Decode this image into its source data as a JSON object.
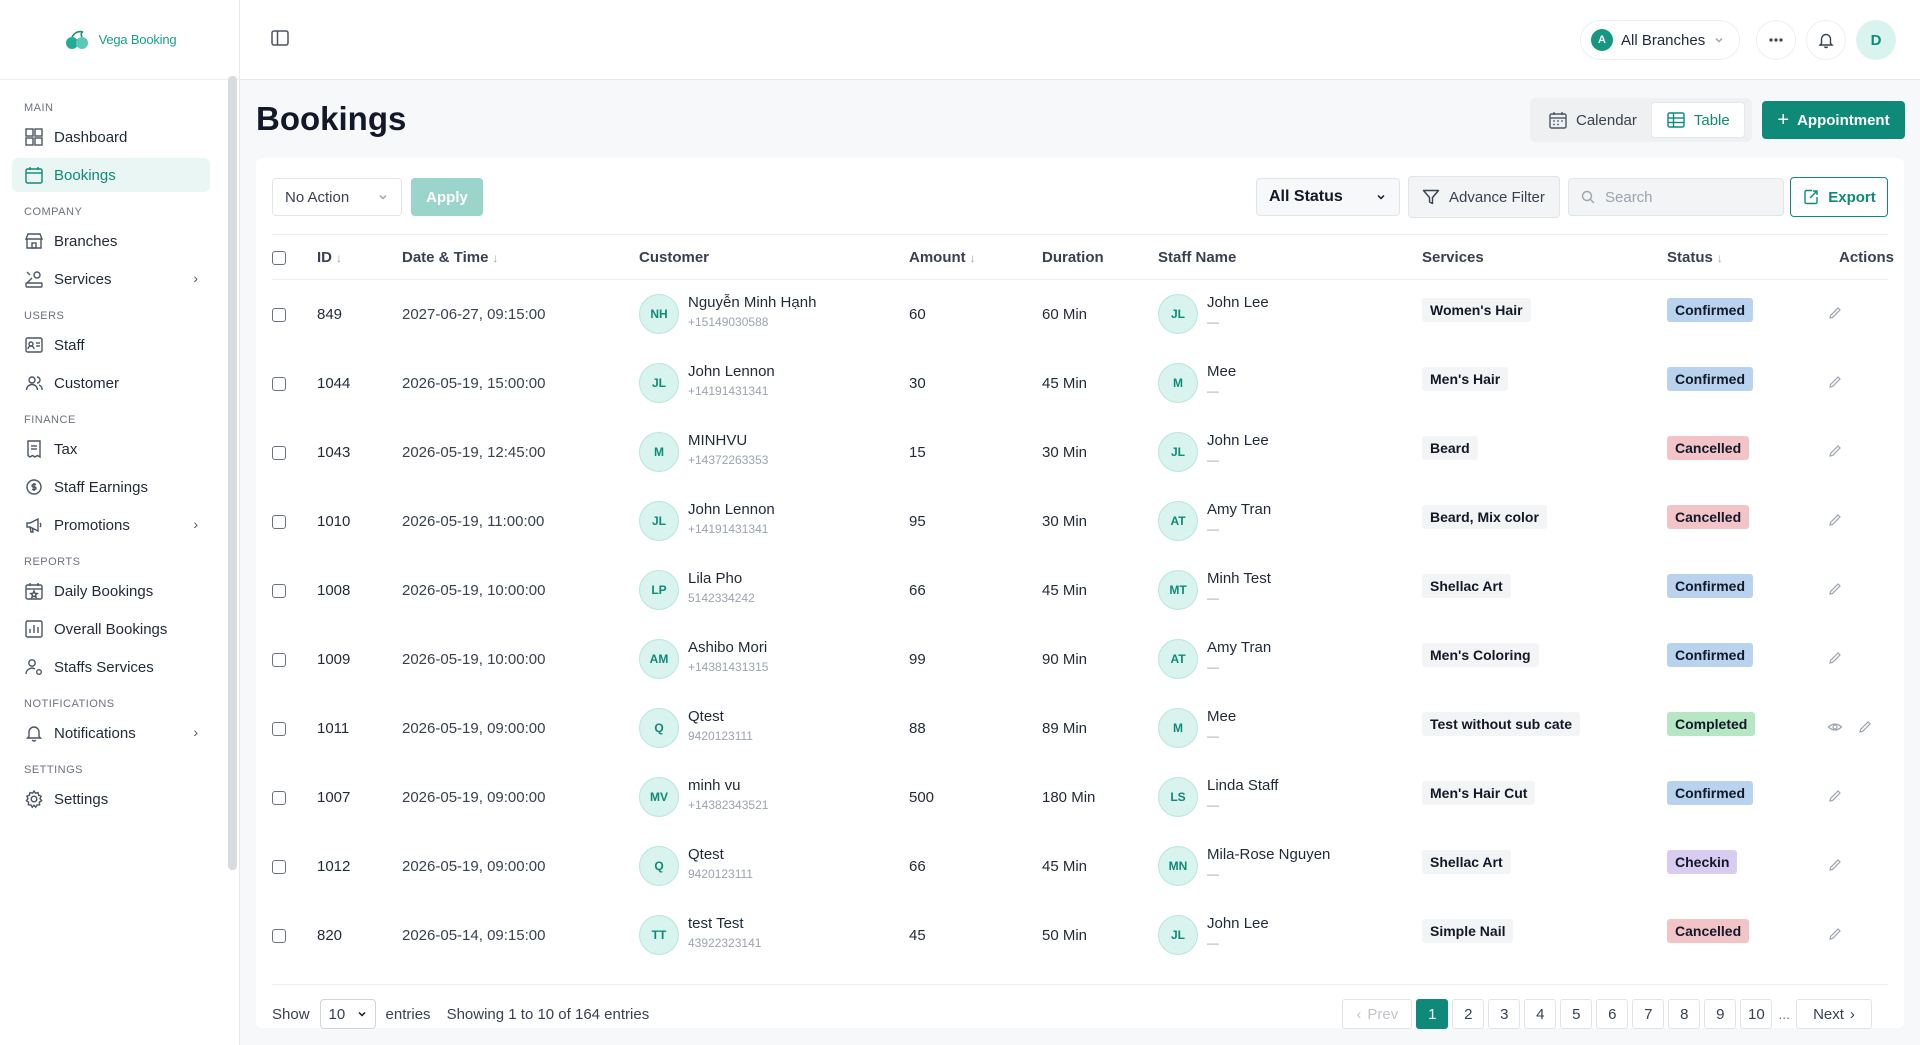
{
  "brand": {
    "name": "Vega Booking"
  },
  "sidebar": {
    "sections": [
      {
        "title": "MAIN",
        "items": [
          {
            "label": "Dashboard",
            "icon": "dashboard-icon",
            "active": false
          },
          {
            "label": "Bookings",
            "icon": "calendar-icon",
            "active": true
          }
        ]
      },
      {
        "title": "COMPANY",
        "items": [
          {
            "label": "Branches",
            "icon": "store-icon"
          },
          {
            "label": "Services",
            "icon": "services-icon",
            "chevron": true
          }
        ]
      },
      {
        "title": "USERS",
        "items": [
          {
            "label": "Staff",
            "icon": "id-card-icon"
          },
          {
            "label": "Customer",
            "icon": "users-icon"
          }
        ]
      },
      {
        "title": "FINANCE",
        "items": [
          {
            "label": "Tax",
            "icon": "receipt-icon"
          },
          {
            "label": "Staff Earnings",
            "icon": "coins-icon"
          },
          {
            "label": "Promotions",
            "icon": "megaphone-icon",
            "chevron": true
          }
        ]
      },
      {
        "title": "REPORTS",
        "items": [
          {
            "label": "Daily Bookings",
            "icon": "calendar-star-icon"
          },
          {
            "label": "Overall Bookings",
            "icon": "bar-chart-icon"
          },
          {
            "label": "Staffs Services",
            "icon": "user-cog-icon"
          }
        ]
      },
      {
        "title": "NOTIFICATIONS",
        "items": [
          {
            "label": "Notifications",
            "icon": "bell-icon",
            "chevron": true
          }
        ]
      },
      {
        "title": "SETTINGS",
        "items": [
          {
            "label": "Settings",
            "icon": "gear-icon"
          }
        ]
      }
    ]
  },
  "topbar": {
    "branch_initial": "A",
    "branch_label": "All Branches",
    "user_initial": "D"
  },
  "page": {
    "title": "Bookings",
    "view_calendar": "Calendar",
    "view_table": "Table",
    "appointment_button": "Appointment"
  },
  "toolbar": {
    "bulk_action": "No Action",
    "apply": "Apply",
    "status_filter": "All Status",
    "advance_filter": "Advance Filter",
    "search_placeholder": "Search",
    "export": "Export"
  },
  "table": {
    "columns": [
      "ID",
      "Date & Time",
      "Customer",
      "Amount",
      "Duration",
      "Staff Name",
      "Services",
      "Status",
      "Actions"
    ],
    "rows": [
      {
        "id": "849",
        "datetime": "2027-06-27, 09:15:00",
        "cust_initials": "NH",
        "cust_name": "Nguyễn Minh Hạnh",
        "cust_phone": "+15149030588",
        "amount": "60",
        "duration": "60 Min",
        "staff_initials": "JL",
        "staff_name": "John Lee",
        "staff_sub": "—",
        "service": "Women's Hair",
        "status": "Confirmed",
        "status_color": "#b9d3ef",
        "view": false
      },
      {
        "id": "1044",
        "datetime": "2026-05-19, 15:00:00",
        "cust_initials": "JL",
        "cust_name": "John Lennon",
        "cust_phone": "+14191431341",
        "amount": "30",
        "duration": "45 Min",
        "staff_initials": "M",
        "staff_name": "Mee",
        "staff_sub": "—",
        "service": "Men's Hair",
        "status": "Confirmed",
        "status_color": "#b9d3ef",
        "view": false
      },
      {
        "id": "1043",
        "datetime": "2026-05-19, 12:45:00",
        "cust_initials": "M",
        "cust_name": "MINHVU",
        "cust_phone": "+14372263353",
        "amount": "15",
        "duration": "30 Min",
        "staff_initials": "JL",
        "staff_name": "John Lee",
        "staff_sub": "—",
        "service": "Beard",
        "status": "Cancelled",
        "status_color": "#f2c4c8",
        "view": false
      },
      {
        "id": "1010",
        "datetime": "2026-05-19, 11:00:00",
        "cust_initials": "JL",
        "cust_name": "John Lennon",
        "cust_phone": "+14191431341",
        "amount": "95",
        "duration": "30 Min",
        "staff_initials": "AT",
        "staff_name": "Amy Tran",
        "staff_sub": "—",
        "service": "Beard, Mix color",
        "status": "Cancelled",
        "status_color": "#f2c4c8",
        "view": false
      },
      {
        "id": "1008",
        "datetime": "2026-05-19, 10:00:00",
        "cust_initials": "LP",
        "cust_name": "Lila Pho",
        "cust_phone": "5142334242",
        "amount": "66",
        "duration": "45 Min",
        "staff_initials": "MT",
        "staff_name": "Minh Test",
        "staff_sub": "—",
        "service": "Shellac Art",
        "status": "Confirmed",
        "status_color": "#b9d3ef",
        "view": false
      },
      {
        "id": "1009",
        "datetime": "2026-05-19, 10:00:00",
        "cust_initials": "AM",
        "cust_name": "Ashibo Mori",
        "cust_phone": "+14381431315",
        "amount": "99",
        "duration": "90 Min",
        "staff_initials": "AT",
        "staff_name": "Amy Tran",
        "staff_sub": "—",
        "service": "Men's Coloring",
        "status": "Confirmed",
        "status_color": "#b9d3ef",
        "view": false
      },
      {
        "id": "1011",
        "datetime": "2026-05-19, 09:00:00",
        "cust_initials": "Q",
        "cust_name": "Qtest",
        "cust_phone": "9420123111",
        "amount": "88",
        "duration": "89 Min",
        "staff_initials": "M",
        "staff_name": "Mee",
        "staff_sub": "—",
        "service": "Test without sub cate",
        "status": "Completed",
        "status_color": "#b6e6c4",
        "view": true
      },
      {
        "id": "1007",
        "datetime": "2026-05-19, 09:00:00",
        "cust_initials": "MV",
        "cust_name": "minh vu",
        "cust_phone": "+14382343521",
        "amount": "500",
        "duration": "180 Min",
        "staff_initials": "LS",
        "staff_name": "Linda Staff",
        "staff_sub": "—",
        "service": "Men's Hair Cut",
        "status": "Confirmed",
        "status_color": "#b9d3ef",
        "view": false
      },
      {
        "id": "1012",
        "datetime": "2026-05-19, 09:00:00",
        "cust_initials": "Q",
        "cust_name": "Qtest",
        "cust_phone": "9420123111",
        "amount": "66",
        "duration": "45 Min",
        "staff_initials": "MN",
        "staff_name": "Mila-Rose Nguyen",
        "staff_sub": "—",
        "service": "Shellac Art",
        "status": "Checkin",
        "status_color": "#d9ccf0",
        "view": false
      },
      {
        "id": "820",
        "datetime": "2026-05-14, 09:15:00",
        "cust_initials": "TT",
        "cust_name": "test Test",
        "cust_phone": "43922323141",
        "amount": "45",
        "duration": "50 Min",
        "staff_initials": "JL",
        "staff_name": "John Lee",
        "staff_sub": "—",
        "service": "Simple Nail",
        "status": "Cancelled",
        "status_color": "#f2c4c8",
        "view": false
      }
    ]
  },
  "footer": {
    "show_label": "Show",
    "page_size": "10",
    "entries_label": "entries",
    "summary": "Showing 1 to 10 of 164 entries",
    "prev": "Prev",
    "next": "Next",
    "pages": [
      "1",
      "2",
      "3",
      "4",
      "5",
      "6",
      "7",
      "8",
      "9",
      "10"
    ],
    "current_page": "1",
    "ellipsis": "..."
  },
  "colors": {
    "accent": "#0f8a78",
    "accent_light": "#d9f3ee"
  }
}
